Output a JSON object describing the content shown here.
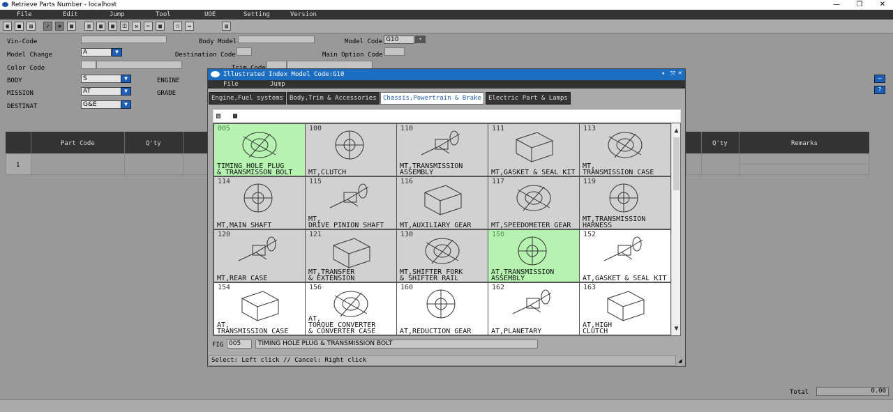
{
  "window": {
    "title": "Retrieve Parts Number - localhost",
    "minimize": "—",
    "restore": "❐",
    "close": "✕"
  },
  "menu": [
    "File",
    "Edit",
    "Jump",
    "Tool",
    "UOE",
    "Setting",
    "Version"
  ],
  "form": {
    "vin_label": "Vin-Code",
    "body_model_label": "Body Model",
    "model_code_label": "Model Code",
    "model_code_value": "G10",
    "model_change_label": "Model Change",
    "model_change_value": "A",
    "destination_label": "Destination Code",
    "main_option_label": "Main Option Code",
    "color_label": "Color Code",
    "trim_label": "Trim Code",
    "body_label": "BODY",
    "body_value": "S",
    "engine_label": "ENGINE",
    "mission_label": "MISSION",
    "mission_value": "AT",
    "grade_label": "GRADE",
    "destinat_label": "DESTINAT",
    "destinat_value": "G&E"
  },
  "table": {
    "headers_left": [
      "Part Code",
      "Q'ty"
    ],
    "headers_right": [
      "Q'ty",
      "Remarks"
    ],
    "row_num": "1",
    "total_label": "Total",
    "total_value": "0.00"
  },
  "dialog": {
    "title": "Illustrated Index Model Code:G10",
    "menu": [
      "File",
      "Jump"
    ],
    "tabs": [
      "Engine,Fuel systems",
      "Body,Trim & Accessories",
      "Chassis,Powertrain & Brake",
      "Electric Part & Lamps"
    ],
    "active_tab": 2,
    "fig_label": "FIG",
    "fig_code": "005",
    "fig_name": "TIMING HOLE PLUG & TRANSMISSION BOLT",
    "status": "Select: Left click // Cancel: Right click",
    "cells": [
      {
        "num": "005",
        "l1": "TIMING HOLE PLUG",
        "l2": "& TRANSMISSON BOLT",
        "state": "hl"
      },
      {
        "num": "100",
        "l1": "",
        "l2": "MT,CLUTCH",
        "state": ""
      },
      {
        "num": "110",
        "l1": "MT,TRANSMISSION",
        "l2": "ASSEMBLY",
        "state": ""
      },
      {
        "num": "111",
        "l1": "",
        "l2": "MT,GASKET & SEAL KIT",
        "state": ""
      },
      {
        "num": "113",
        "l1": "MT,",
        "l2": "TRANSMISSION CASE",
        "state": ""
      },
      {
        "num": "114",
        "l1": "",
        "l2": "MT,MAIN SHAFT",
        "state": ""
      },
      {
        "num": "115",
        "l1": "MT,",
        "l2": "DRIVE PINION SHAFT",
        "state": ""
      },
      {
        "num": "116",
        "l1": "",
        "l2": "MT,AUXILIARY GEAR",
        "state": ""
      },
      {
        "num": "117",
        "l1": "",
        "l2": "MT,SPEEDOMETER GEAR",
        "state": ""
      },
      {
        "num": "119",
        "l1": "MT,TRANSMISSION",
        "l2": "HARNESS",
        "state": ""
      },
      {
        "num": "120",
        "l1": "",
        "l2": "MT,REAR CASE",
        "state": ""
      },
      {
        "num": "121",
        "l1": "MT,TRANSFER",
        "l2": "& EXTENSION",
        "state": ""
      },
      {
        "num": "130",
        "l1": "MT,SHIFTER FORK",
        "l2": "& SHIFTER RAIL",
        "state": ""
      },
      {
        "num": "150",
        "l1": "AT,TRANSMISSION",
        "l2": "ASSEMBLY",
        "state": "hl"
      },
      {
        "num": "152",
        "l1": "",
        "l2": "AT,GASKET & SEAL KIT",
        "state": "white"
      },
      {
        "num": "154",
        "l1": "AT,",
        "l2": "TRANSMISSION  CASE",
        "state": "white"
      },
      {
        "num": "156",
        "l1": "AT,",
        "l2": "TORQUE CONVERTER",
        "l3": "& CONVERTER CASE",
        "state": "white"
      },
      {
        "num": "160",
        "l1": "",
        "l2": "AT,REDUCTION GEAR",
        "state": "white"
      },
      {
        "num": "162",
        "l1": "",
        "l2": "AT,PLANETARY",
        "state": "white"
      },
      {
        "num": "163",
        "l1": "AT,HIGH",
        "l2": "CLUTCH",
        "state": "white"
      }
    ]
  }
}
